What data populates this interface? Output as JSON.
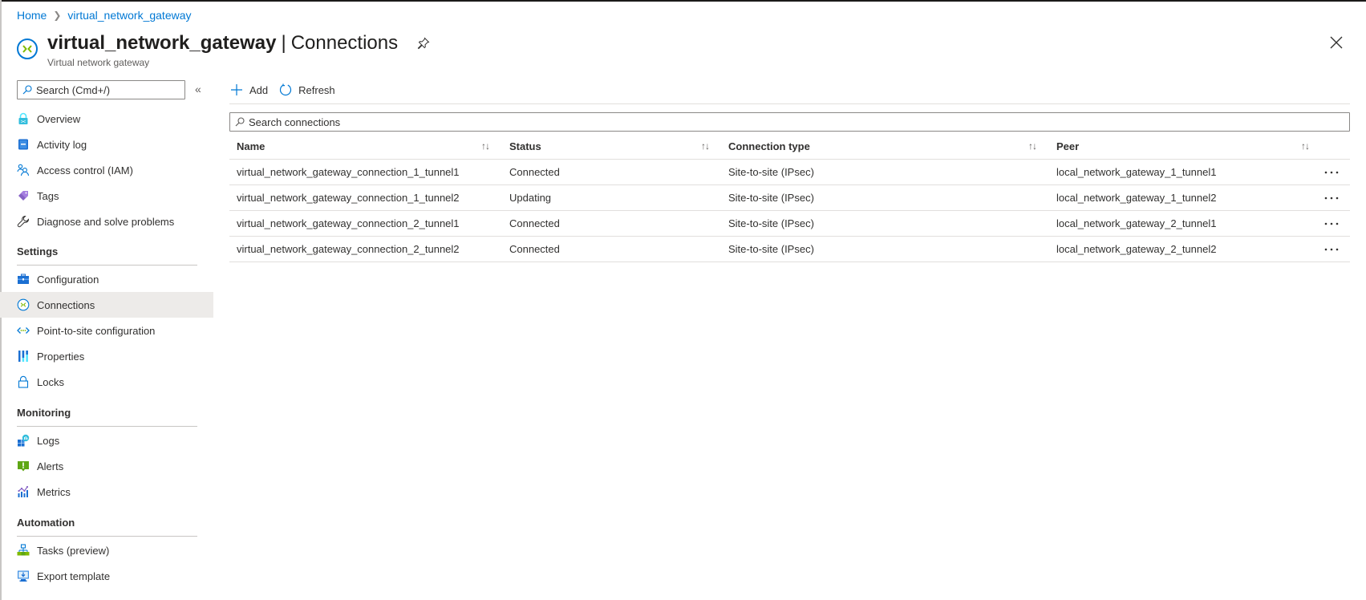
{
  "breadcrumb": [
    {
      "label": "Home"
    },
    {
      "label": "virtual_network_gateway"
    }
  ],
  "header": {
    "resource_name": "virtual_network_gateway",
    "separator": "|",
    "blade_title": "Connections",
    "subtitle": "Virtual network gateway",
    "icon": "virtual-network-gateway-icon"
  },
  "sidebar": {
    "search_placeholder": "Search (Cmd+/)",
    "collapse_glyph": "«",
    "items_top": [
      {
        "label": "Overview",
        "icon": "overview-icon"
      },
      {
        "label": "Activity log",
        "icon": "activity-log-icon"
      },
      {
        "label": "Access control (IAM)",
        "icon": "iam-icon"
      },
      {
        "label": "Tags",
        "icon": "tag-icon"
      },
      {
        "label": "Diagnose and solve problems",
        "icon": "wrench-icon"
      }
    ],
    "sections": [
      {
        "title": "Settings",
        "items": [
          {
            "label": "Configuration",
            "icon": "configuration-icon"
          },
          {
            "label": "Connections",
            "icon": "connections-icon",
            "selected": true
          },
          {
            "label": "Point-to-site configuration",
            "icon": "point-to-site-icon"
          },
          {
            "label": "Properties",
            "icon": "properties-icon"
          },
          {
            "label": "Locks",
            "icon": "lock-icon"
          }
        ]
      },
      {
        "title": "Monitoring",
        "items": [
          {
            "label": "Logs",
            "icon": "logs-icon"
          },
          {
            "label": "Alerts",
            "icon": "alerts-icon"
          },
          {
            "label": "Metrics",
            "icon": "metrics-icon"
          }
        ]
      },
      {
        "title": "Automation",
        "items": [
          {
            "label": "Tasks (preview)",
            "icon": "tasks-icon"
          },
          {
            "label": "Export template",
            "icon": "export-template-icon"
          }
        ]
      }
    ]
  },
  "toolbar": {
    "add_label": "Add",
    "refresh_label": "Refresh"
  },
  "connections": {
    "search_placeholder": "Search connections",
    "columns": [
      "Name",
      "Status",
      "Connection type",
      "Peer"
    ],
    "sort_glyph": "↑↓",
    "more_glyph": "•••",
    "rows": [
      {
        "name": "virtual_network_gateway_connection_1_tunnel1",
        "status": "Connected",
        "type": "Site-to-site (IPsec)",
        "peer": "local_network_gateway_1_tunnel1"
      },
      {
        "name": "virtual_network_gateway_connection_1_tunnel2",
        "status": "Updating",
        "type": "Site-to-site (IPsec)",
        "peer": "local_network_gateway_1_tunnel2"
      },
      {
        "name": "virtual_network_gateway_connection_2_tunnel1",
        "status": "Connected",
        "type": "Site-to-site (IPsec)",
        "peer": "local_network_gateway_2_tunnel1"
      },
      {
        "name": "virtual_network_gateway_connection_2_tunnel2",
        "status": "Connected",
        "type": "Site-to-site (IPsec)",
        "peer": "local_network_gateway_2_tunnel2"
      }
    ]
  },
  "colors": {
    "link": "#0078d4",
    "selected_bg": "#edebe9",
    "text": "#323130",
    "divider": "#e1dfdd"
  }
}
